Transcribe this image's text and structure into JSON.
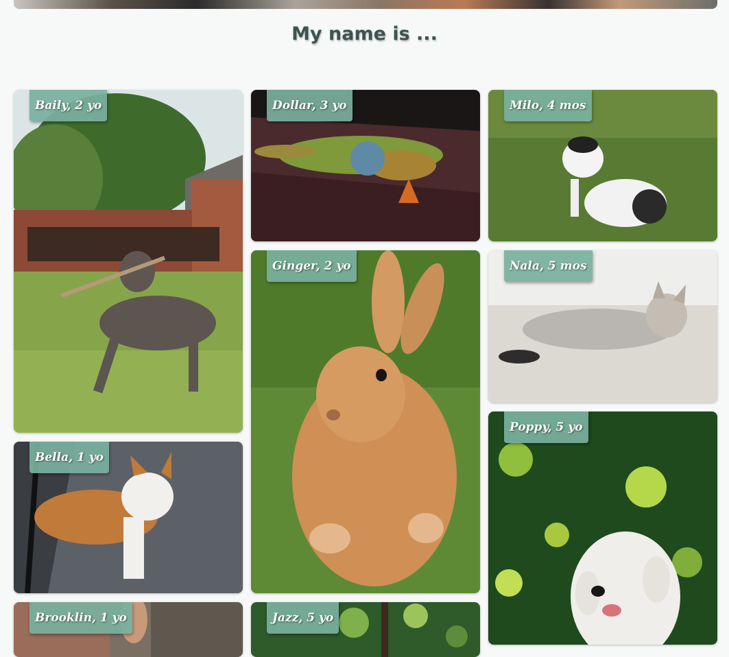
{
  "page": {
    "title": "My name is ..."
  },
  "pets": [
    {
      "label": "Baily, 2 yo",
      "image": "dog-weimaraner-with-stick"
    },
    {
      "label": "Dollar, 3 yo",
      "image": "iguana-on-wood"
    },
    {
      "label": "Milo, 4 mos",
      "image": "black-white-kitten-on-grass"
    },
    {
      "label": "Ginger, 2 yo",
      "image": "orange-rabbit-on-grass"
    },
    {
      "label": "Nala, 5 mos",
      "image": "tabby-kitten-on-rug"
    },
    {
      "label": "Bella, 1 yo",
      "image": "orange-white-cat-on-mat"
    },
    {
      "label": "Poppy, 5 yo",
      "image": "white-terrier-bokeh"
    },
    {
      "label": "Brooklin, 1 yo",
      "image": "pet-photo"
    },
    {
      "label": "Jazz, 5 yo",
      "image": "pet-photo"
    }
  ],
  "colors": {
    "tag": "#7ab09e",
    "title": "#3d5350",
    "background": "#f6f9f8"
  }
}
